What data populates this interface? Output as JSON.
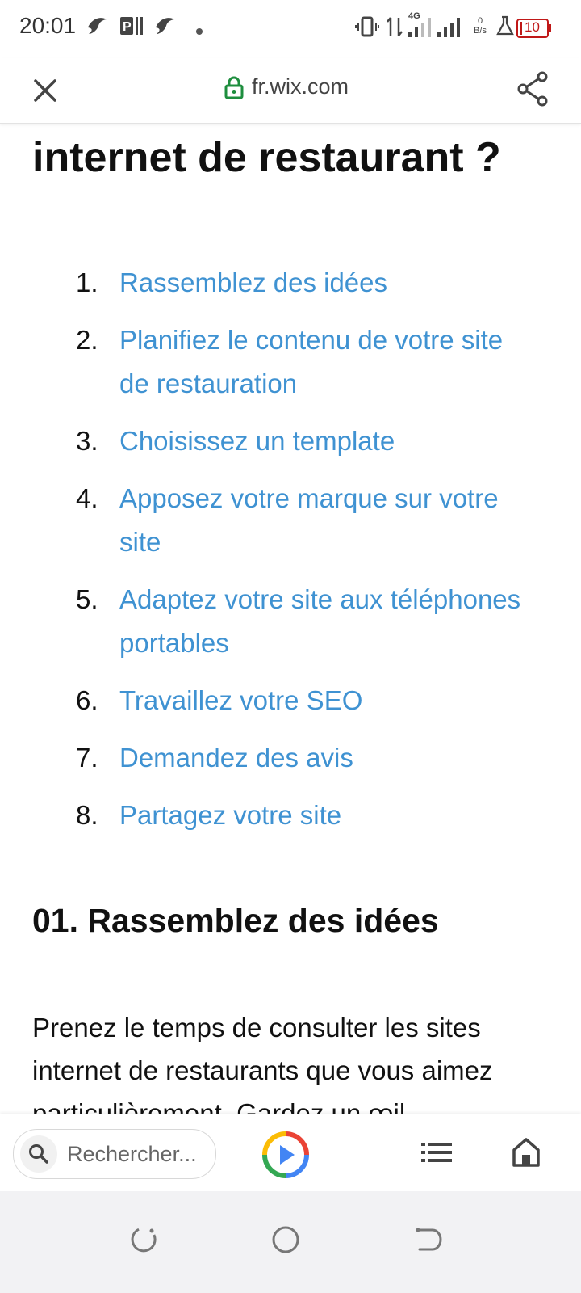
{
  "status_bar": {
    "time": "20:01",
    "network_type": "4G",
    "data_rate": "0",
    "data_rate_unit": "B/s",
    "battery": "10",
    "icons": [
      "bird-icon",
      "parking-icon",
      "bird-icon",
      "dot-icon",
      "vibrate-icon",
      "data-arrows-icon",
      "signal-icon",
      "signal-icon",
      "flask-icon",
      "battery-icon"
    ]
  },
  "url_bar": {
    "domain": "fr.wix.com",
    "icons": [
      "close-icon",
      "lock-icon",
      "share-icon"
    ],
    "lock_color": "#1e8e3e"
  },
  "article": {
    "heading": "internet de restaurant ?",
    "link_color": "#3f92d2",
    "toc": [
      {
        "num": "1.",
        "label": "Rassemblez des idées"
      },
      {
        "num": "2.",
        "label": "Planifiez le contenu de votre site de restauration"
      },
      {
        "num": "3.",
        "label": "Choisissez un template"
      },
      {
        "num": "4.",
        "label": "Apposez votre marque sur votre site"
      },
      {
        "num": "5.",
        "label": "Adaptez votre site aux téléphones portables"
      },
      {
        "num": "6.",
        "label": "Travaillez votre SEO"
      },
      {
        "num": "7.",
        "label": "Demandez des avis"
      },
      {
        "num": "8.",
        "label": "Partagez votre site"
      }
    ],
    "section_title": "01. Rassemblez des idées",
    "paragraph": "Prenez le temps de consulter les sites internet de restaurants que vous aimez particulièrement. Gardez un œil"
  },
  "bottom_bar": {
    "search_placeholder": "Rechercher...",
    "icons": [
      "search-icon",
      "play-icon",
      "list-icon",
      "home-icon"
    ]
  },
  "nav_bar": {
    "icons": [
      "recents-icon",
      "home-circle-icon",
      "back-icon"
    ]
  }
}
